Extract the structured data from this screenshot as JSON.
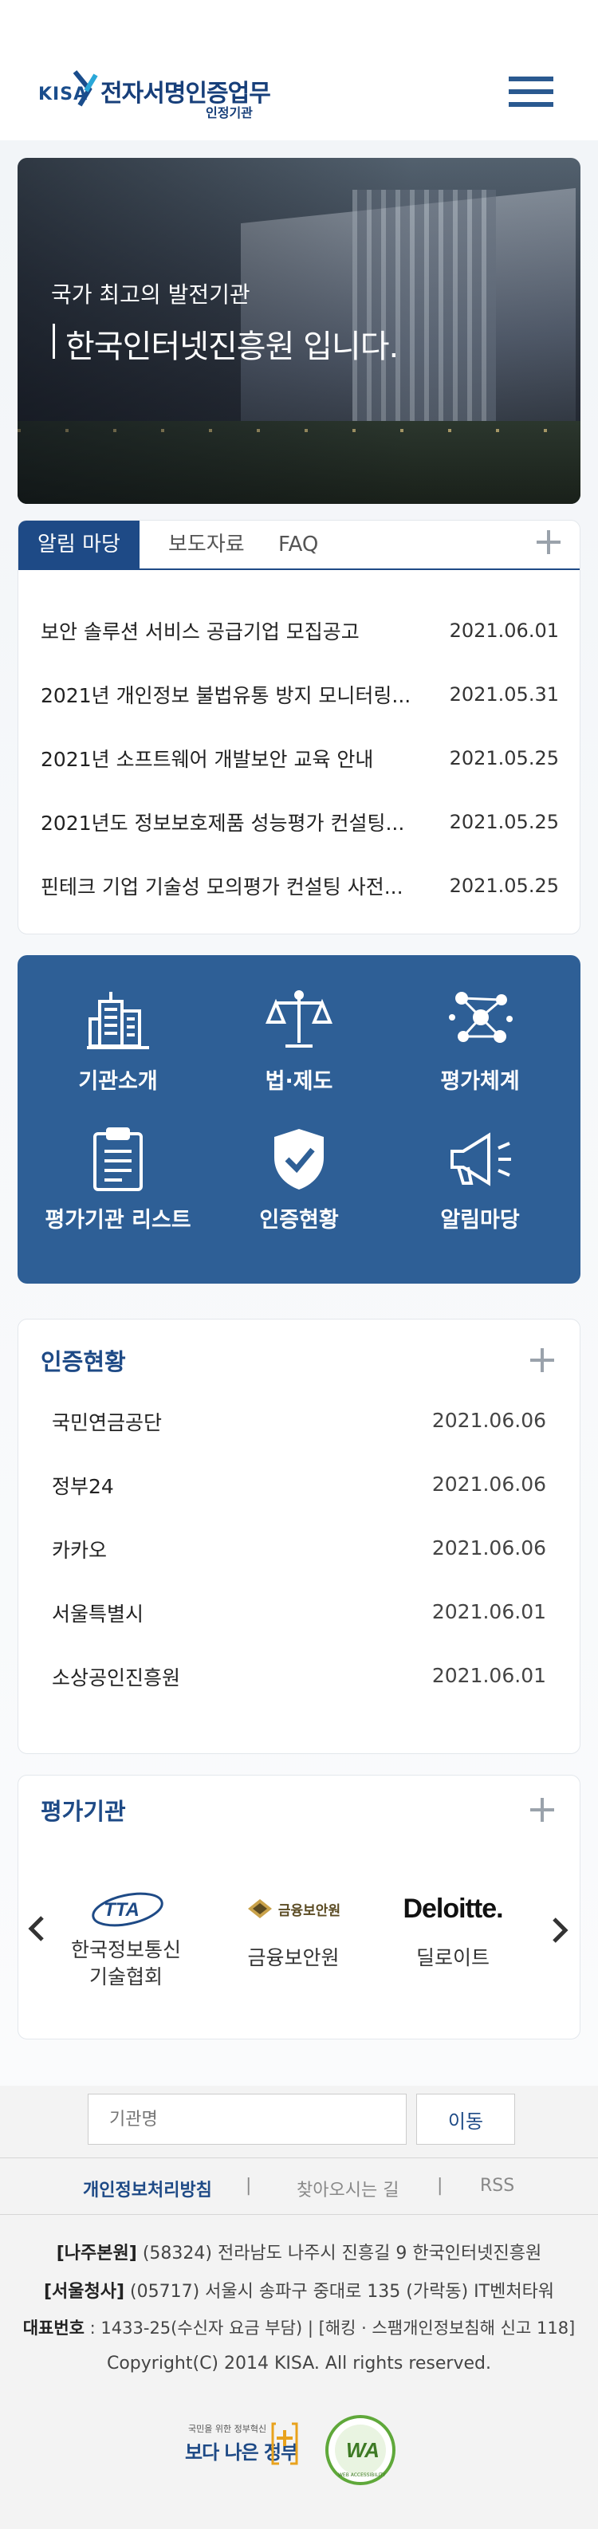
{
  "header": {
    "logo_mark": "KISA",
    "logo_title": "전자서명인증업무",
    "logo_sub": "인정기관"
  },
  "hero": {
    "line1": "국가 최고의 발전기관",
    "line2": "한국인터넷진흥원 입니다."
  },
  "notice": {
    "tabs": [
      {
        "label": "알림 마당",
        "active": true
      },
      {
        "label": "보도자료",
        "active": false
      },
      {
        "label": "FAQ",
        "active": false
      }
    ],
    "items": [
      {
        "title": "보안 솔루션 서비스 공급기업 모집공고",
        "date": "2021.06.01"
      },
      {
        "title": "2021년 개인정보 불법유통 방지 모니터링...",
        "date": "2021.05.31"
      },
      {
        "title": "2021년 소프트웨어 개발보안 교육 안내",
        "date": "2021.05.25"
      },
      {
        "title": "2021년도 정보보호제품 성능평가 컨설팅...",
        "date": "2021.05.25"
      },
      {
        "title": "핀테크 기업 기술성 모의평가 컨설팅 사전...",
        "date": "2021.05.25"
      }
    ]
  },
  "quick_menu": [
    {
      "label": "기관소개",
      "icon": "building-icon"
    },
    {
      "label": "법·제도",
      "icon": "scale-icon"
    },
    {
      "label": "평가체계",
      "icon": "network-icon"
    },
    {
      "label": "평가기관 리스트",
      "icon": "clipboard-list-icon"
    },
    {
      "label": "인증현황",
      "icon": "shield-check-icon"
    },
    {
      "label": "알림마당",
      "icon": "megaphone-icon"
    }
  ],
  "certification": {
    "title": "인증현황",
    "items": [
      {
        "name": "국민연금공단",
        "date": "2021.06.06"
      },
      {
        "name": "정부24",
        "date": "2021.06.06"
      },
      {
        "name": "카카오",
        "date": "2021.06.06"
      },
      {
        "name": "서울특별시",
        "date": "2021.06.01"
      },
      {
        "name": "소상공인진흥원",
        "date": "2021.06.01"
      }
    ]
  },
  "evaluation": {
    "title": "평가기관",
    "orgs": [
      {
        "logo": "TTA",
        "label_line1": "한국정보통신",
        "label_line2": "기술협회"
      },
      {
        "logo": "금융보안원",
        "label_line1": "금융보안원",
        "label_line2": ""
      },
      {
        "logo": "Deloitte.",
        "label_line1": "딜로이트",
        "label_line2": ""
      }
    ]
  },
  "footer": {
    "search_placeholder": "기관명",
    "go_label": "이동",
    "links": [
      "개인정보처리방침",
      "찾아오시는 길",
      "RSS"
    ],
    "separator": "|",
    "addr1_label": "[나주본원]",
    "addr1": "(58324) 전라남도 나주시 진흥길 9 한국인터넷진흥원",
    "addr2_label": "[서울청사]",
    "addr2": "(05717) 서울시 송파구 중대로 135 (가락동) IT벤처타워",
    "phone_label": "대표번호",
    "phone": " : 1433-25(수신자 요금 부담) | [해킹 · 스팸개인정보침해 신고 118]",
    "copyright": "Copyright(C) 2014 KISA. All rights reserved.",
    "badge1_top": "국민을 위한 정부혁신",
    "badge1": "보다 나은 정부",
    "badge2": "WA",
    "badge2_ring": "WEB ACCESSIBILITY"
  },
  "colors": {
    "brand": "#1e4a86",
    "quick_bg": "#2e5f96"
  }
}
